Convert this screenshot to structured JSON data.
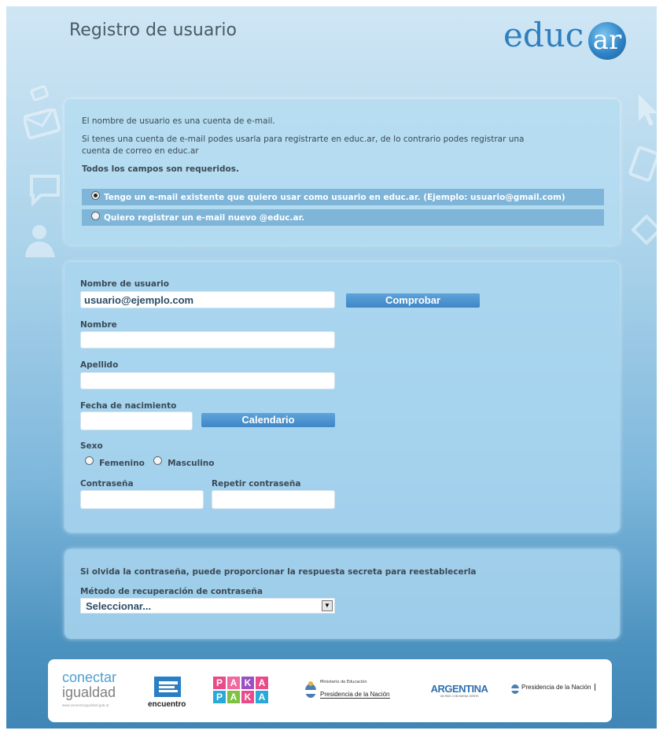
{
  "header": {
    "title": "Registro de usuario",
    "logo_text": "educ",
    "logo_ball_text": "ar"
  },
  "info": {
    "line1": "El nombre de usuario es una cuenta de e-mail.",
    "line2": "Si tenes una cuenta de e-mail podes usarla para registrarte en educ.ar, de lo contrario podes registrar una",
    "line3": "cuenta de correo en educ.ar",
    "required": "Todos los campos son requeridos.",
    "option_existing": "Tengo un e-mail existente que quiero usar como usuario en educ.ar. (Ejemplo: usuario@gmail.com)",
    "option_new": "Quiero registrar un e-mail nuevo @educ.ar.",
    "selected_option": "existing"
  },
  "form": {
    "username_label": "Nombre de usuario",
    "username_value": "usuario@ejemplo.com",
    "check_button": "Comprobar",
    "name_label": "Nombre",
    "surname_label": "Apellido",
    "birthdate_label": "Fecha de nacimiento",
    "calendar_button": "Calendario",
    "sex_label": "Sexo",
    "sex_female": "Femenino",
    "sex_male": "Masculino",
    "password_label": "Contraseña",
    "repeat_password_label": "Repetir contraseña"
  },
  "recovery": {
    "hint": "Si olvida la contraseña, puede proporcionar la respuesta secreta para reestablecerla",
    "method_label": "Método de recuperación de contraseña",
    "method_value": "Seleccionar..."
  },
  "footer": {
    "conectar_line1": "conectar",
    "conectar_line2": "igualdad",
    "conectar_url": "www.conectarigualdad.gob.ar",
    "encuentro": "encuentro",
    "pakapaka_top": [
      "P",
      "A",
      "K",
      "A"
    ],
    "pakapaka_bottom": [
      "P",
      "A",
      "K",
      "A"
    ],
    "ministerio_small": "Ministerio de Educación",
    "ministerio_main": "Presidencia de la Nación",
    "argentina": "ARGENTINA",
    "argentina_sub": "UN PAIS CON BUENA GENTE",
    "presidencia": "Presidencia de la Nación"
  },
  "colors": {
    "accent": "#3f86c6",
    "panel": "#b4dcf2",
    "footer_bg": "#ffffff"
  }
}
